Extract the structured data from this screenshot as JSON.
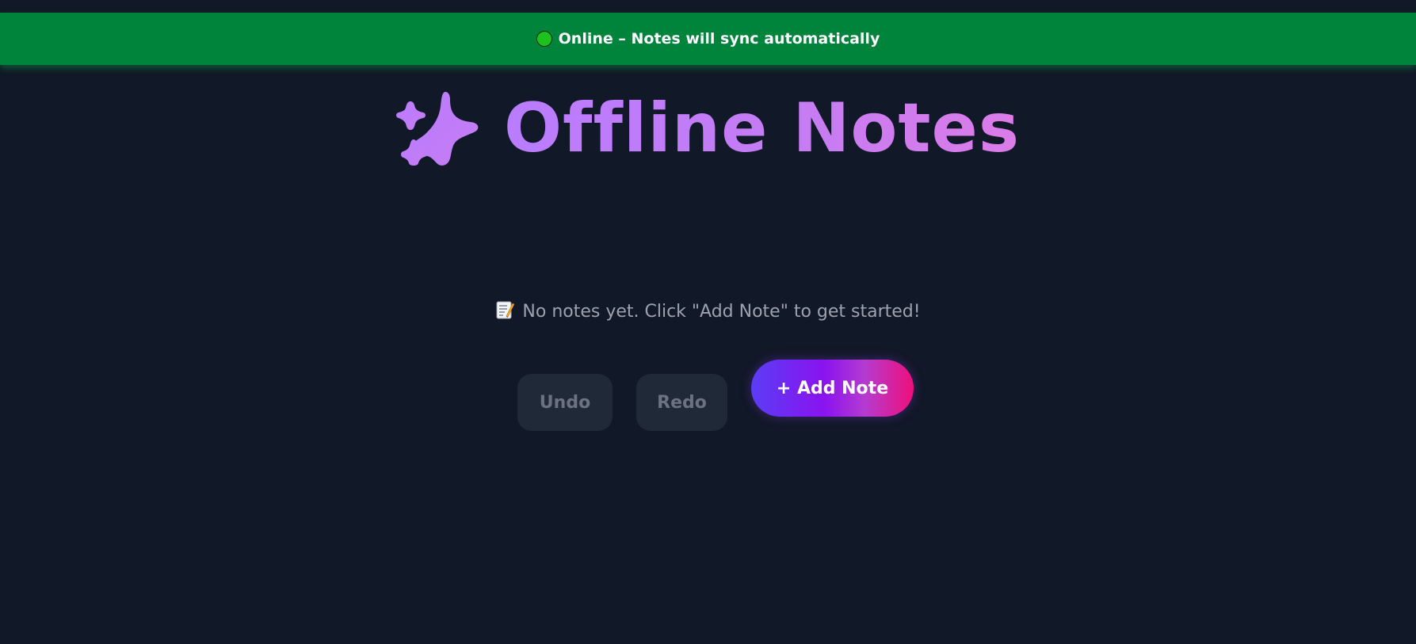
{
  "status": {
    "text": "Online – Notes will sync automatically",
    "indicator_color": "#1ec21e",
    "banner_color": "#00833a"
  },
  "header": {
    "title": "Offline Notes",
    "icon": "sparkle-icon",
    "title_color": "#c77dff"
  },
  "empty_state": {
    "icon": "memo-icon",
    "text": "No notes yet. Click \"Add Note\" to get started!"
  },
  "toolbar": {
    "undo_label": "Undo",
    "redo_label": "Redo",
    "add_label": "+ Add Note"
  },
  "colors": {
    "background": "#111827",
    "disabled_button": "#1f2937",
    "add_gradient": [
      "#5b3df5",
      "#8a13f0",
      "#ef0f7a"
    ]
  }
}
